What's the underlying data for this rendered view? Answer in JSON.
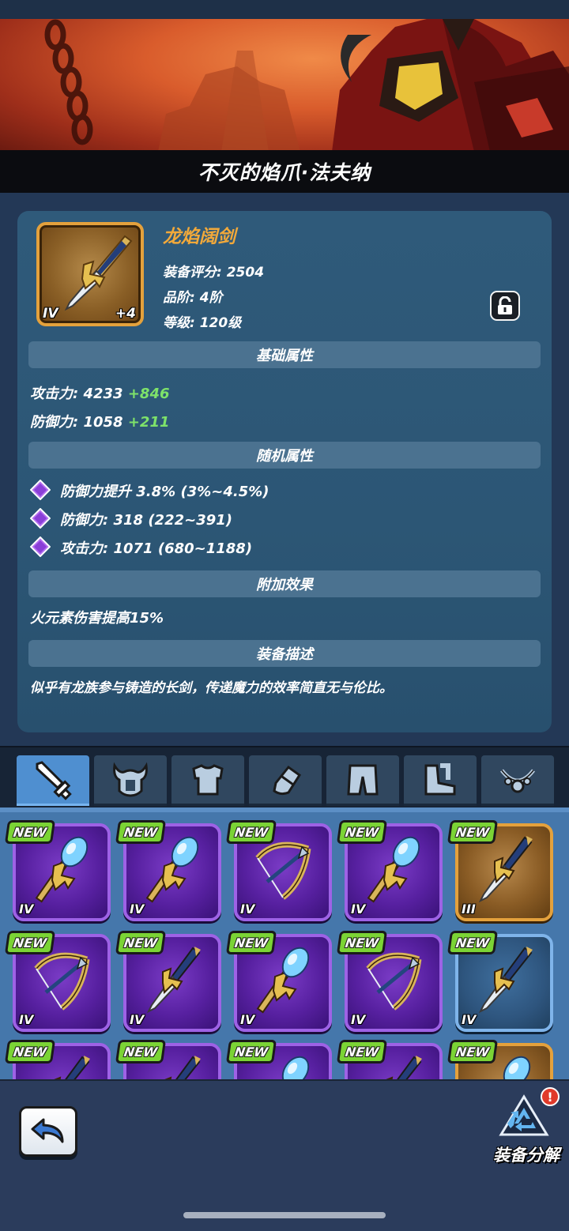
{
  "hero": {
    "title": "不灭的焰爪·法夫纳"
  },
  "item": {
    "name": "龙焰阔剑",
    "tier_badge": "IV",
    "enhance": "+4",
    "score": "装备评分: 2504",
    "grade": "品阶: 4阶",
    "level": "等级: 120级"
  },
  "sections": {
    "base": "基础属性",
    "random": "随机属性",
    "extra": "附加效果",
    "desc": "装备描述"
  },
  "base_attrs": [
    {
      "label": "攻击力: 4233",
      "bonus": "+846"
    },
    {
      "label": "防御力: 1058",
      "bonus": "+211"
    }
  ],
  "random_attrs": [
    {
      "label": "防御力提升 3.8%",
      "range": "(3%~4.5%)"
    },
    {
      "label": "防御力: 318",
      "range": "(222~391)"
    },
    {
      "label": "攻击力: 1071",
      "range": "(680~1188)"
    }
  ],
  "extra_effect": "火元素伤害提高15%",
  "description": "似乎有龙族参与铸造的长剑，传递魔力的效率简直无与伦比。",
  "tabs": [
    {
      "icon": "sword-icon"
    },
    {
      "icon": "helmet-icon"
    },
    {
      "icon": "chest-armor-icon"
    },
    {
      "icon": "gauntlet-icon"
    },
    {
      "icon": "leg-armor-icon"
    },
    {
      "icon": "boots-icon"
    },
    {
      "icon": "necklace-icon"
    }
  ],
  "inventory": {
    "new_label": "NEW",
    "rows": [
      [
        {
          "rarity": "purple",
          "kind": "staff",
          "tier": "IV"
        },
        {
          "rarity": "purple",
          "kind": "staff",
          "tier": "IV"
        },
        {
          "rarity": "purple",
          "kind": "bow",
          "tier": "IV"
        },
        {
          "rarity": "purple",
          "kind": "staff",
          "tier": "IV"
        },
        {
          "rarity": "gold",
          "kind": "sword",
          "tier": "III"
        }
      ],
      [
        {
          "rarity": "purple",
          "kind": "bow",
          "tier": "IV"
        },
        {
          "rarity": "purple",
          "kind": "sword",
          "tier": "IV"
        },
        {
          "rarity": "purple",
          "kind": "staff",
          "tier": "IV"
        },
        {
          "rarity": "purple",
          "kind": "bow",
          "tier": "IV"
        },
        {
          "rarity": "blue",
          "kind": "sword",
          "tier": "IV"
        }
      ],
      [
        {
          "rarity": "purple",
          "kind": "sword"
        },
        {
          "rarity": "purple",
          "kind": "sword"
        },
        {
          "rarity": "purple",
          "kind": "staff"
        },
        {
          "rarity": "purple",
          "kind": "sword"
        },
        {
          "rarity": "gold",
          "kind": "staff"
        }
      ]
    ]
  },
  "actions": {
    "back": "back-arrow-icon",
    "salvage": "装备分解",
    "alert": "!"
  },
  "colors": {
    "accent_orange": "#f2a93a",
    "bonus_green": "#7ee26a",
    "new_green": "#7bd435",
    "epic_purple": "#9e62e6"
  }
}
